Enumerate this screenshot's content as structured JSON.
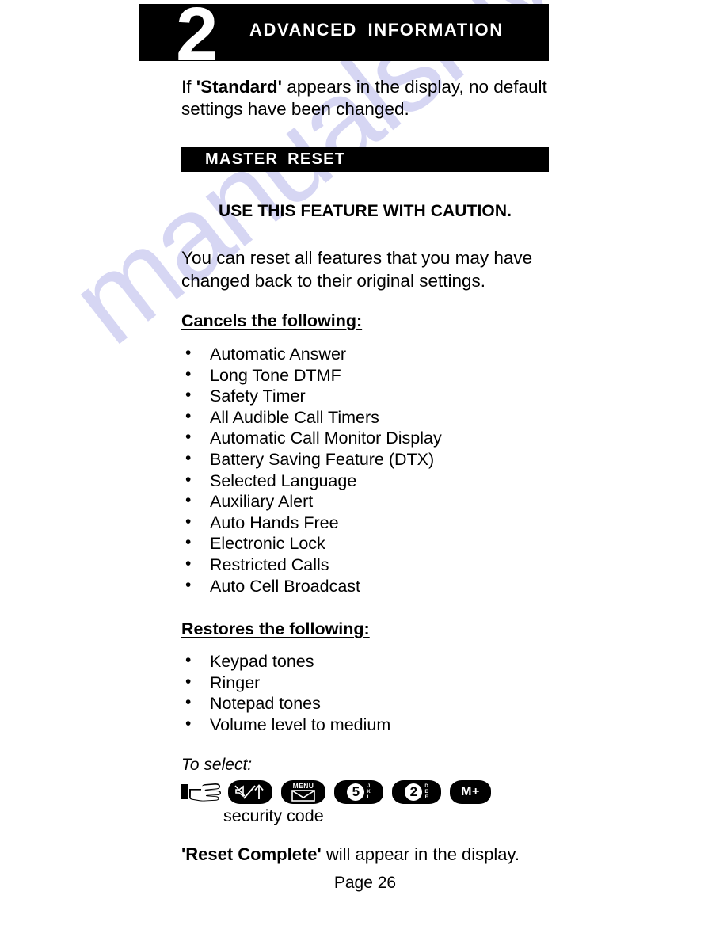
{
  "watermark": {
    "text": "manualshive.com",
    "color": "#cfcff2"
  },
  "chapter": {
    "number": "2",
    "title": "ADVANCED  INFORMATION"
  },
  "intro": {
    "prefix": "If ",
    "bold": "'Standard'",
    "suffix": " appears in the display, no default settings have been changed."
  },
  "section": {
    "bar_title": "MASTER  RESET",
    "caution": "USE THIS FEATURE WITH CAUTION.",
    "paragraph": "You can reset all features that you may have changed back to their original settings."
  },
  "cancels": {
    "heading": "Cancels the following:",
    "items": [
      "Automatic Answer",
      "Long Tone DTMF",
      "Safety Timer",
      "All Audible Call Timers",
      "Automatic Call Monitor Display",
      "Battery Saving Feature (DTX)",
      "Selected Language",
      "Auxiliary Alert",
      "Auto Hands Free",
      "Electronic Lock",
      "Restricted Calls",
      "Auto Cell Broadcast"
    ]
  },
  "restores": {
    "heading": "Restores the following:",
    "items": [
      "Keypad tones",
      "Ringer",
      "Notepad tones",
      "Volume level to medium"
    ]
  },
  "procedure": {
    "to_select": "To select:",
    "keys": [
      {
        "name": "mute-up-key",
        "label": ""
      },
      {
        "name": "menu-key",
        "label": "MENU"
      },
      {
        "name": "digit-5-key",
        "label": "5",
        "side": "JKL"
      },
      {
        "name": "digit-2-key",
        "label": "2",
        "side": "DEF"
      },
      {
        "name": "memory-plus-key",
        "label": "M+"
      }
    ],
    "security_code": "security code"
  },
  "closing": {
    "bold": "'Reset Complete'",
    "rest": " will appear in the display."
  },
  "footer": {
    "page": "Page 26"
  }
}
